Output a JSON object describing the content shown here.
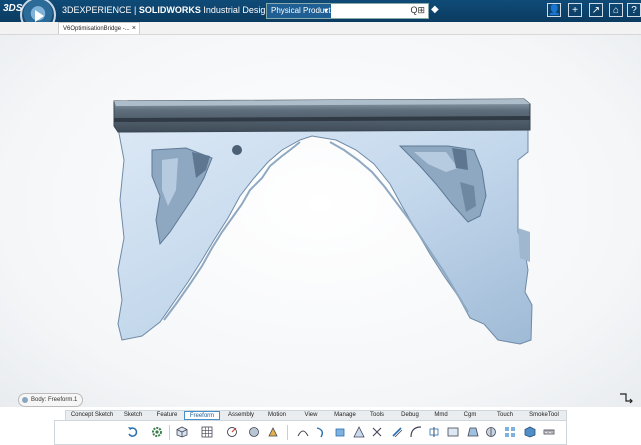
{
  "app": {
    "logo": "3DS",
    "brand_prefix": "3DEXPERIENCE",
    "brand_sep": " | ",
    "brand_product": "SOLIDWORKS",
    "brand_suffix": " Industrial Design"
  },
  "search": {
    "scope": "Physical Product",
    "value": ""
  },
  "toolbar_icons": [
    "user-icon",
    "add-icon",
    "share-icon",
    "home-icon",
    "help-icon"
  ],
  "doc_tab": {
    "label": "V6OptimisationBridge -...",
    "close": "×"
  },
  "status": {
    "body_label": "Body: Freeform.1"
  },
  "ribbon": {
    "tabs": [
      "Concept Sketch",
      "Sketch",
      "Feature",
      "Freeform",
      "Assembly",
      "Motion",
      "View",
      "Manage",
      "Tools",
      "Debug",
      "Mmd",
      "Cgm",
      "Touch",
      "SmokeTool"
    ],
    "active_tab": "Freeform"
  },
  "colors": {
    "topbar": "#0d4470",
    "accent": "#4a90c8",
    "model_fill": "#c6d9ec",
    "model_top": "#6c7c8a"
  }
}
